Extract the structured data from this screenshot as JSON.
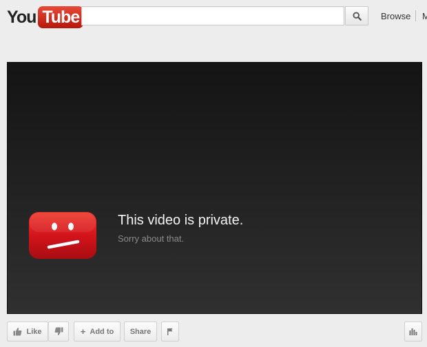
{
  "header": {
    "logo": {
      "you": "You",
      "tube": "Tube"
    },
    "search": {
      "value": "",
      "placeholder": ""
    },
    "nav": {
      "browse": "Browse",
      "next_clipped": "M"
    }
  },
  "player": {
    "title": "This video is private.",
    "subtitle": "Sorry about that."
  },
  "actions": {
    "like": "Like",
    "add_to": "Add to",
    "share": "Share"
  },
  "colors": {
    "logo_red": "#cc181e",
    "sad_icon_red": "#d4141b",
    "page_bg": "#ededed",
    "player_bg": "#1e1e1e"
  }
}
